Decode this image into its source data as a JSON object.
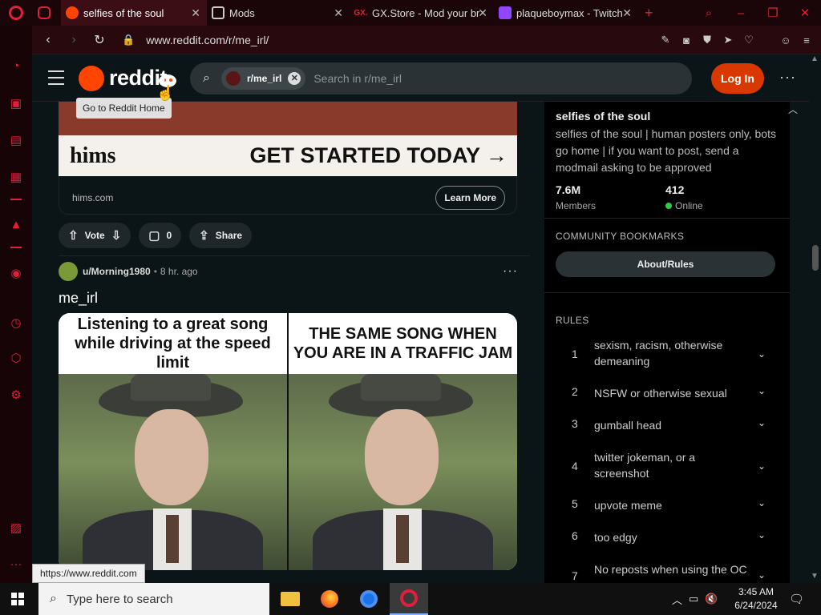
{
  "browser": {
    "tabs": [
      {
        "label": "",
        "icon": "messenger-icon"
      },
      {
        "label": "selfies of the soul",
        "icon": "reddit-icon",
        "active": true
      },
      {
        "label": "Mods",
        "icon": "mods-icon"
      },
      {
        "label": "GX.Store - Mod your br",
        "icon": "gx-store-icon",
        "favicon_text": "GX."
      },
      {
        "label": "plaqueboymax - Twitch",
        "icon": "twitch-icon"
      }
    ],
    "url": "www.reddit.com/r/me_irl/"
  },
  "reddit": {
    "wordmark": "reddit",
    "tooltip": "Go to Reddit Home",
    "search": {
      "chip": "r/me_irl",
      "placeholder": "Search in r/me_irl"
    },
    "login": "Log In",
    "ad": {
      "brand": "hims",
      "cta": "GET STARTED TODAY →",
      "domain": "hims.com",
      "learn_more": "Learn More"
    },
    "post_actions": {
      "vote": "Vote",
      "comments": "0",
      "share": "Share"
    },
    "post": {
      "author": "u/Morning1980",
      "age": "8 hr. ago",
      "title": "me_irl",
      "meme_left": "Listening to a great song while driving at the speed limit",
      "meme_right": "THE SAME SONG WHEN YOU ARE IN A TRAFFIC JAM"
    },
    "status_url": "https://www.reddit.com",
    "community": {
      "name": "selfies of the soul",
      "description": "selfies of the soul | human posters only, bots go home | if you want to post, send a modmail asking to be approved",
      "members_value": "7.6M",
      "members_label": "Members",
      "online_value": "412",
      "online_label": "Online",
      "bookmarks_heading": "COMMUNITY BOOKMARKS",
      "about_button": "About/Rules",
      "rules_heading": "RULES",
      "rules": [
        {
          "n": "1",
          "text": "sexism, racism, otherwise demeaning"
        },
        {
          "n": "2",
          "text": "NSFW or otherwise sexual"
        },
        {
          "n": "3",
          "text": "gumball head"
        },
        {
          "n": "4",
          "text": "twitter jokeman, or a screenshot"
        },
        {
          "n": "5",
          "text": "upvote meme"
        },
        {
          "n": "6",
          "text": "too edgy"
        },
        {
          "n": "7",
          "text": "No reposts when using the OC"
        }
      ]
    }
  },
  "taskbar": {
    "search_placeholder": "Type here to search",
    "time": "3:45 AM",
    "date": "6/24/2024",
    "notification_count": "1"
  }
}
